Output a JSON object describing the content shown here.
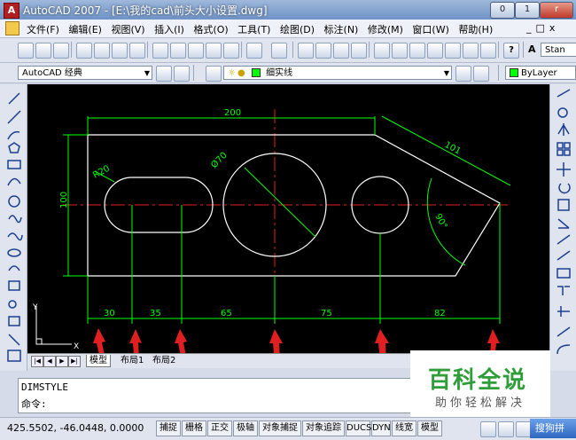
{
  "window": {
    "title": "AutoCAD 2007 - [E:\\我的cad\\前头大小设置.dwg]",
    "controls": [
      "0",
      "1",
      "r"
    ],
    "doc_controls": [
      "_",
      "□",
      "x"
    ]
  },
  "menu": [
    "文件(F)",
    "编辑(E)",
    "视图(V)",
    "插入(I)",
    "格式(O)",
    "工具(T)",
    "绘图(D)",
    "标注(N)",
    "修改(M)",
    "窗口(W)",
    "帮助(H)"
  ],
  "toolbar": {
    "style_partial": "Stan",
    "workspace": "AutoCAD 经典",
    "layer": "细实线",
    "color": "ByLayer",
    "layer_color": "#00ff00"
  },
  "drawing": {
    "dim_color": "#00ff00",
    "outline_color": "#ffffff",
    "center_color": "#ff0000",
    "arrow_color": "#e02020",
    "labels": {
      "dia70": "Ø70",
      "r20": "R20",
      "height": "100",
      "width": "200",
      "slant": "101",
      "angle": "90°",
      "d30": "30",
      "d35": "35",
      "d65": "65",
      "d75": "75",
      "d82": "82"
    }
  },
  "tabs": {
    "model": "模型",
    "layout1": "布局1",
    "layout2": "布局2",
    "nav": [
      "|◀",
      "◀",
      "▶",
      "▶|"
    ]
  },
  "command": {
    "history": "DIMSTYLE",
    "prompt": "命令:"
  },
  "status": {
    "coords": "425.5502, -46.0448, 0.0000",
    "buttons": [
      "捕捉",
      "栅格",
      "正交",
      "极轴",
      "对象捕捉",
      "对象追踪",
      "DUCS",
      "DYN",
      "线宽",
      "模型"
    ]
  },
  "watermark": {
    "main": "百科全说",
    "sub": "助你轻松解决"
  },
  "ime": {
    "label": "搜狗拼"
  },
  "ucs": {
    "x": "X",
    "y": "Y"
  }
}
